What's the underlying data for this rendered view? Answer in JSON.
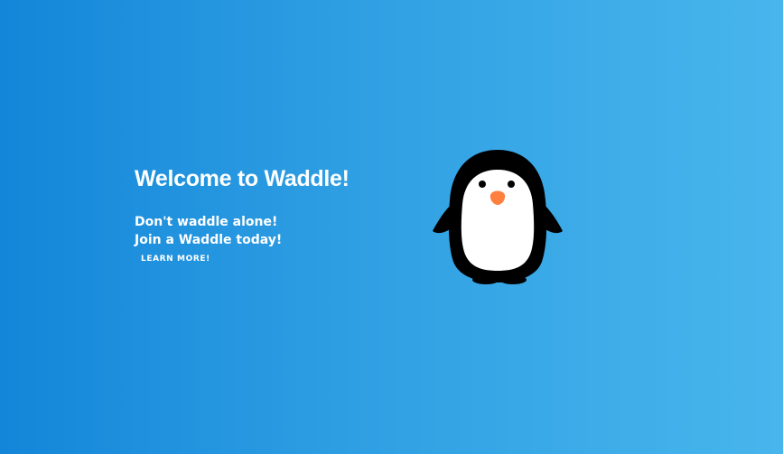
{
  "hero": {
    "title": "Welcome to Waddle!",
    "tagline_line1": "Don't waddle alone!",
    "tagline_line2": "Join a Waddle today!",
    "cta_label": "LEARN MORE!"
  },
  "illustration": {
    "icon": "penguin-icon"
  },
  "colors": {
    "gradient_start": "#1386d9",
    "gradient_end": "#48b6ec",
    "text": "#ffffff",
    "penguin_body": "#000000",
    "penguin_belly": "#ffffff",
    "penguin_beak": "#ff7f3f"
  }
}
